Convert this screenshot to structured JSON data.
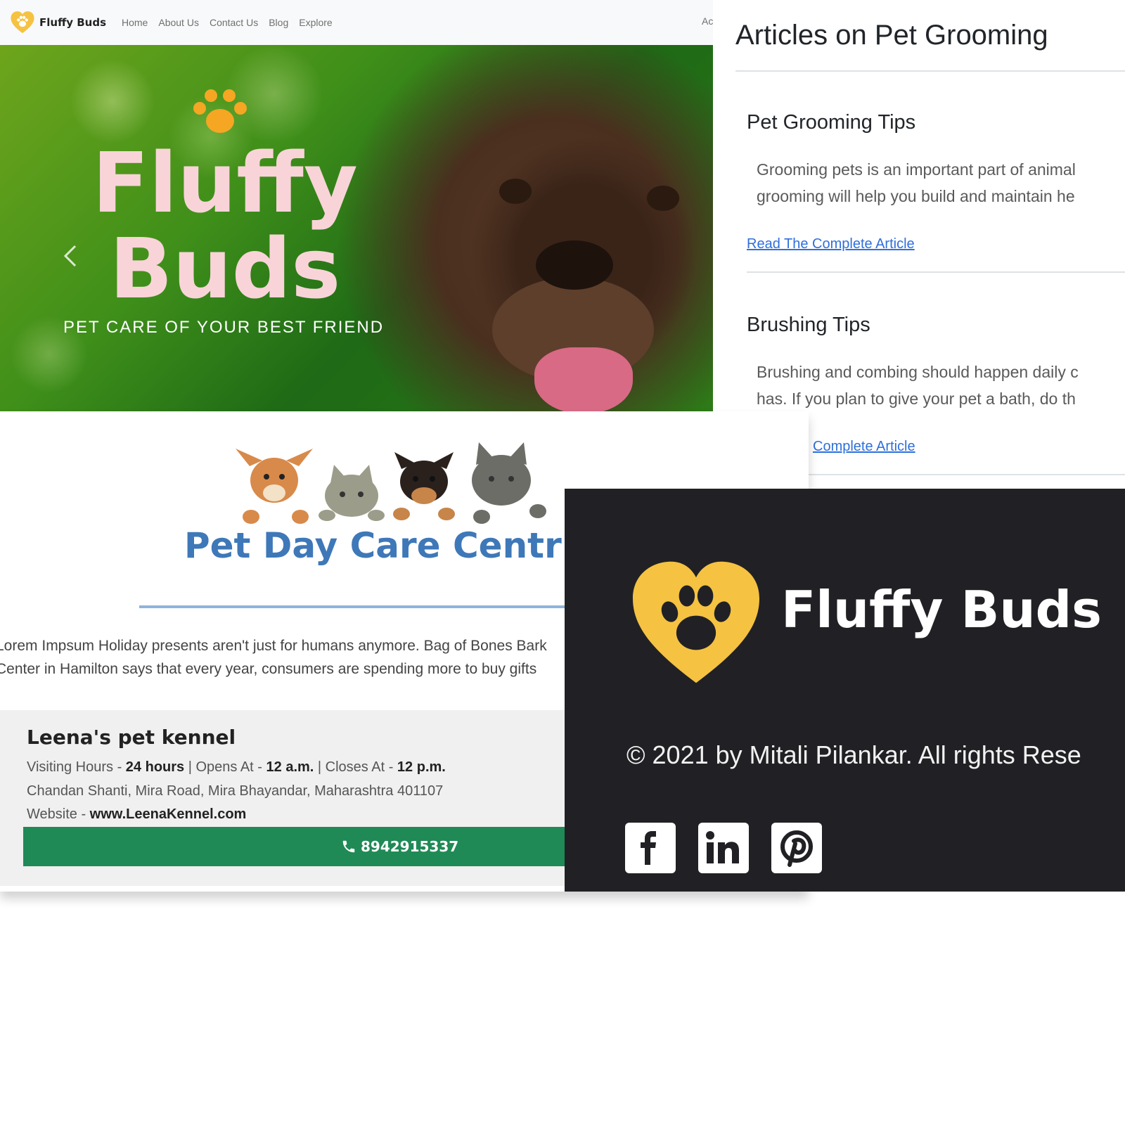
{
  "header": {
    "brand": "Fluffy Buds",
    "nav": [
      "Home",
      "About Us",
      "Contact Us",
      "Blog",
      "Explore"
    ],
    "nav_cut": "Ac"
  },
  "hero": {
    "title_line1": "Fluffy",
    "title_line2": "Buds",
    "tagline": "PET CARE OF YOUR BEST FRIEND",
    "prev_icon": "chevron-left-icon"
  },
  "articles": {
    "heading": "Articles on Pet Grooming",
    "items": [
      {
        "title": "Pet Grooming Tips",
        "lines": [
          "Grooming pets is an important part of animal",
          "grooming will help you build and maintain he"
        ],
        "link": "Read The Complete Article"
      },
      {
        "title": "Brushing Tips",
        "lines": [
          "Brushing and combing should happen daily c",
          "has. If you plan to give your pet a bath, do th"
        ],
        "link": "Complete Article"
      }
    ]
  },
  "daycare": {
    "title": "Pet Day Care Centr",
    "text_lines": [
      "Lorem Impsum Holiday presents aren't just for humans anymore. Bag of Bones Bark",
      "Center in Hamilton says that every year, consumers are spending more to buy gifts"
    ],
    "kennel": {
      "name": "Leena's pet kennel",
      "visiting_label": "Visiting Hours - ",
      "visiting_value": "24 hours",
      "opens_label": " | Opens At - ",
      "opens_value": "12 a.m.",
      "closes_label": " | Closes At - ",
      "closes_value": "12 p.m.",
      "address": "Chandan Shanti, Mira Road, Mira Bhayandar, Maharashtra 401107",
      "website_label": "Website - ",
      "website_value": "www.LeenaKennel.com",
      "phone": "8942915337",
      "phone_icon": "phone-icon"
    }
  },
  "footer": {
    "brand": "Fluffy Buds",
    "copyright": "© 2021 by Mitali Pilankar. All rights Rese",
    "social": [
      "facebook-icon",
      "linkedin-icon",
      "pinterest-icon"
    ]
  },
  "colors": {
    "brand_yellow": "#f5c242",
    "paw_orange": "#f5a623",
    "hero_title": "#f8d4d8",
    "daycare_blue": "#3e78b8",
    "call_green": "#1f8a55",
    "footer_bg": "#212125",
    "link_blue": "#2f6fdb"
  }
}
